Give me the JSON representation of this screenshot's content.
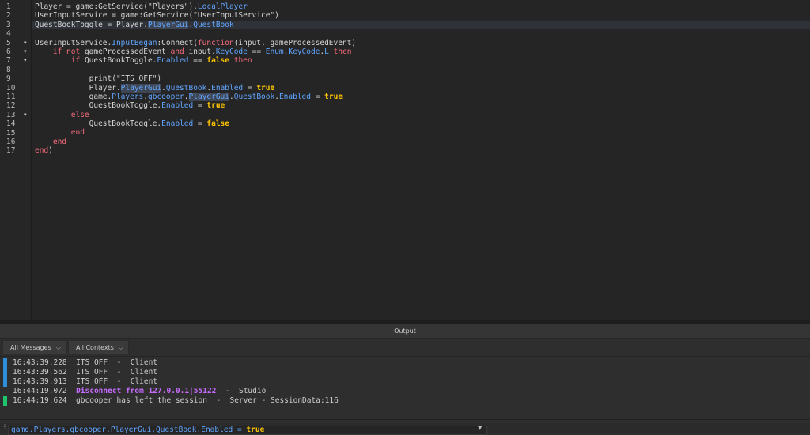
{
  "editor": {
    "current_line": 3,
    "folds": [
      5,
      6,
      7,
      13
    ],
    "lines": [
      [
        [
          "Player = game:GetService(\"Players\").",
          ""
        ],
        [
          "LocalPlayer",
          "prop"
        ]
      ],
      [
        [
          "UserInputService = game:GetService(\"UserInputService\")",
          ""
        ]
      ],
      [
        [
          "QuestBookToggle = Player.",
          ""
        ],
        [
          "PlayerGui",
          "sel"
        ],
        [
          ".",
          ""
        ],
        [
          "QuestBook",
          "prop"
        ]
      ],
      [],
      [
        [
          "UserInputService.",
          ""
        ],
        [
          "InputBegan",
          "prop"
        ],
        [
          ":Connect(",
          ""
        ],
        [
          "function",
          "kw"
        ],
        [
          "(input, gameProcessedEvent)",
          ""
        ]
      ],
      [
        [
          "    ",
          ""
        ],
        [
          "if not",
          "kw"
        ],
        [
          " gameProcessedEvent ",
          ""
        ],
        [
          "and",
          "kw"
        ],
        [
          " input.",
          ""
        ],
        [
          "KeyCode",
          "prop"
        ],
        [
          " == ",
          ""
        ],
        [
          "Enum",
          "prop"
        ],
        [
          ".",
          ""
        ],
        [
          "KeyCode",
          "prop"
        ],
        [
          ".",
          ""
        ],
        [
          "L",
          "prop"
        ],
        [
          " ",
          ""
        ],
        [
          "then",
          "kw"
        ]
      ],
      [
        [
          "        ",
          ""
        ],
        [
          "if",
          "kw"
        ],
        [
          " QuestBookToggle.",
          ""
        ],
        [
          "Enabled",
          "prop"
        ],
        [
          " == ",
          ""
        ],
        [
          "false",
          "bool"
        ],
        [
          " ",
          ""
        ],
        [
          "then",
          "kw"
        ]
      ],
      [],
      [
        [
          "            print(\"ITS OFF\")",
          ""
        ]
      ],
      [
        [
          "            Player.",
          ""
        ],
        [
          "PlayerGui",
          "sel"
        ],
        [
          ".",
          ""
        ],
        [
          "QuestBook",
          "prop"
        ],
        [
          ".",
          ""
        ],
        [
          "Enabled",
          "prop"
        ],
        [
          " = ",
          ""
        ],
        [
          "true",
          "bool"
        ]
      ],
      [
        [
          "            game.",
          ""
        ],
        [
          "Players",
          "prop"
        ],
        [
          ".",
          ""
        ],
        [
          "gbcooper",
          "prop"
        ],
        [
          ".",
          ""
        ],
        [
          "PlayerGui",
          "sel"
        ],
        [
          ".",
          ""
        ],
        [
          "QuestBook",
          "prop"
        ],
        [
          ".",
          ""
        ],
        [
          "Enabled",
          "prop"
        ],
        [
          " = ",
          ""
        ],
        [
          "true",
          "bool"
        ]
      ],
      [
        [
          "            QuestBookToggle.",
          ""
        ],
        [
          "Enabled",
          "prop"
        ],
        [
          " = ",
          ""
        ],
        [
          "true",
          "bool"
        ]
      ],
      [
        [
          "        ",
          ""
        ],
        [
          "else",
          "kw"
        ]
      ],
      [
        [
          "            QuestBookToggle.",
          ""
        ],
        [
          "Enabled",
          "prop"
        ],
        [
          " = ",
          ""
        ],
        [
          "false",
          "bool"
        ]
      ],
      [
        [
          "        ",
          ""
        ],
        [
          "end",
          "kw"
        ]
      ],
      [
        [
          "    ",
          ""
        ],
        [
          "end",
          "kw"
        ]
      ],
      [
        [
          "end",
          "kw"
        ],
        [
          ")",
          ""
        ]
      ]
    ]
  },
  "output": {
    "title": "Output",
    "filter_messages": "All Messages",
    "filter_contexts": "All Contexts",
    "entries": [
      {
        "time": "16:43:39.228",
        "msg": "ITS OFF",
        "src": "  -  Client",
        "type": "info",
        "mark": "#2f8ed8"
      },
      {
        "time": "16:43:39.562",
        "msg": "ITS OFF",
        "src": "  -  Client",
        "type": "info",
        "mark": "#2f8ed8"
      },
      {
        "time": "16:43:39.913",
        "msg": "ITS OFF",
        "src": "  -  Client",
        "type": "info",
        "mark": "#2f8ed8"
      },
      {
        "time": "16:44:19.072",
        "msg": "Disconnect from 127.0.0.1|55122",
        "src": "  -  Studio",
        "type": "err",
        "mark": ""
      },
      {
        "time": "16:44:19.624",
        "msg": "gbcooper has left the session",
        "src": "  -  Server - SessionData:116",
        "type": "info",
        "mark": "#1fc46b"
      }
    ]
  },
  "command_bar": {
    "value_parts": [
      [
        "game.Players.gbcooper.PlayerGui.QuestBook.Enabled = ",
        "prop"
      ],
      [
        "true",
        "bool"
      ]
    ]
  }
}
